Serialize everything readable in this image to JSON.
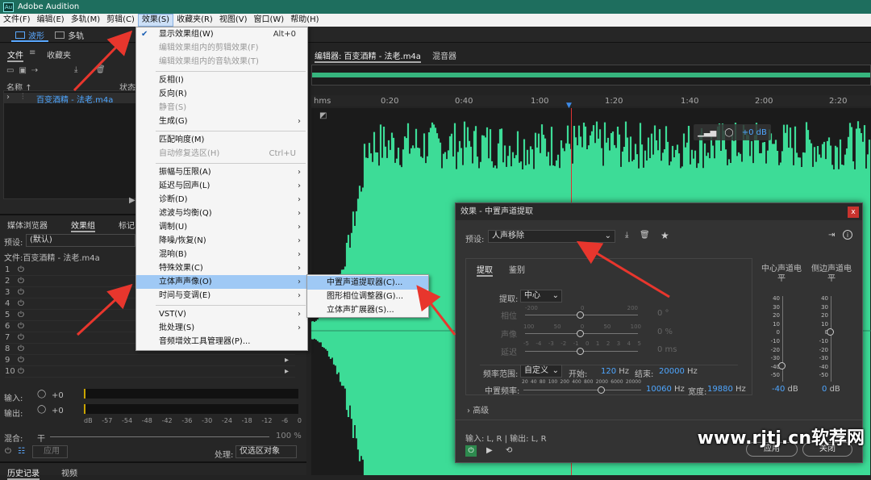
{
  "app": {
    "title": "Adobe Audition",
    "logo": "Au"
  },
  "menubar": [
    "文件(F)",
    "编辑(E)",
    "多轨(M)",
    "剪辑(C)",
    "效果(S)",
    "收藏夹(R)",
    "视图(V)",
    "窗口(W)",
    "帮助(H)"
  ],
  "toolbar": {
    "waveform": "波形",
    "multitrack": "多轨"
  },
  "files_panel": {
    "tab_files": "文件",
    "tab_favorites": "收藏夹",
    "col_name": "名称",
    "col_status": "状态",
    "file": "百变酒精 - 法老.m4a"
  },
  "effects_panel": {
    "tab_media": "媒体浏览器",
    "tab_effects": "效果组",
    "tab_markers": "标记",
    "preset_label": "预设:",
    "preset_value": "(默认)",
    "file_label": "文件:百变酒精 - 法老.m4a",
    "tracks": [
      "1",
      "2",
      "3",
      "4",
      "5",
      "6",
      "7",
      "8",
      "9",
      "10"
    ],
    "input_label": "输入:",
    "output_label": "输出:",
    "level": "+0",
    "db_scale": [
      "dB",
      "-57",
      "-54",
      "-48",
      "-42",
      "-36",
      "-30",
      "-24",
      "-18",
      "-12",
      "-6",
      "0"
    ],
    "mix_label": "混合:",
    "mix_dry": "干",
    "mix_pct": "100 %",
    "apply": "应用",
    "process_label": "处理:",
    "process_value": "仅选区对象",
    "history_tab": "历史记录",
    "video_tab": "视频"
  },
  "editor": {
    "tab": "编辑器: 百变酒精 - 法老.m4a",
    "mixer_tab": "混音器",
    "ruler": [
      "hms",
      "0:20",
      "0:40",
      "1:00",
      "1:20",
      "1:40",
      "2:00",
      "2:20"
    ],
    "hud_db": "+0 dB",
    "wave_color": "#3ddc97"
  },
  "effects_menu": {
    "show_rack": "显示效果组(W)",
    "show_rack_sc": "Alt+0",
    "edit_clip": "编辑效果组内的剪辑效果(F)",
    "edit_track": "编辑效果组内的音轨效果(T)",
    "invert": "反相(I)",
    "reverse": "反向(R)",
    "silence": "静音(S)",
    "generate": "生成(G)",
    "match": "匹配响度(M)",
    "auto_heal": "自动修复选区(H)",
    "auto_heal_sc": "Ctrl+U",
    "amp": "振幅与压限(A)",
    "delay": "延迟与回声(L)",
    "diag": "诊断(D)",
    "filter": "滤波与均衡(Q)",
    "mod": "调制(U)",
    "noise": "降噪/恢复(N)",
    "reverb": "混响(B)",
    "special": "特殊效果(C)",
    "stereo": "立体声声像(O)",
    "time": "时间与变调(E)",
    "vst": "VST(V)",
    "batch": "批处理(S)",
    "plugin_mgr": "音频增效工具管理器(P)..."
  },
  "stereo_submenu": [
    "中置声道提取器(C)...",
    "图形相位调整器(G)...",
    "立体声扩展器(S)..."
  ],
  "dialog": {
    "title": "效果 - 中置声道提取",
    "close": "x",
    "preset_label": "预设:",
    "preset_value": "人声移除",
    "tab_extract": "提取",
    "tab_discrim": "鉴别",
    "extract_label": "提取:",
    "extract_value": "中心",
    "phase_label": "相位",
    "phase_scale": [
      "-200",
      "0",
      "200"
    ],
    "phase_val": "0 °",
    "pan_label": "声像",
    "pan_scale": [
      "100",
      "50",
      "0",
      "50",
      "100"
    ],
    "pan_val": "0 %",
    "delay_label": "延迟",
    "delay_scale": [
      "-5",
      "-4",
      "-3",
      "-2",
      "-1",
      "0",
      "1",
      "2",
      "3",
      "4",
      "5"
    ],
    "delay_val": "0 ms",
    "freq_label": "频率范围:",
    "freq_value": "自定义",
    "start_label": "开始:",
    "start_val": "120",
    "start_unit": "Hz",
    "end_label": "结束:",
    "end_val": "20000",
    "end_unit": "Hz",
    "center_freq_label": "中置频率:",
    "center_freq_scale": [
      "20",
      "40",
      "80",
      "100",
      "200",
      "400",
      "800",
      "2000",
      "6000",
      "20000"
    ],
    "center_freq_val": "10060",
    "cf_unit": "Hz",
    "width_label": "宽度:",
    "width_val": "19880",
    "width_unit": "Hz",
    "center_level": "中心声道电平",
    "side_level": "侧边声道电平",
    "vscale": [
      "40",
      "30",
      "20",
      "10",
      "0",
      "-10",
      "-20",
      "-30",
      "-40",
      "-50"
    ],
    "center_db": "-40",
    "side_db": "0",
    "db_unit": "dB",
    "advanced": "高级",
    "io": "输入: L, R | 输出: L, R",
    "apply": "应用",
    "close_btn": "关闭"
  },
  "watermark": "www.rjtj.cn软荐网"
}
